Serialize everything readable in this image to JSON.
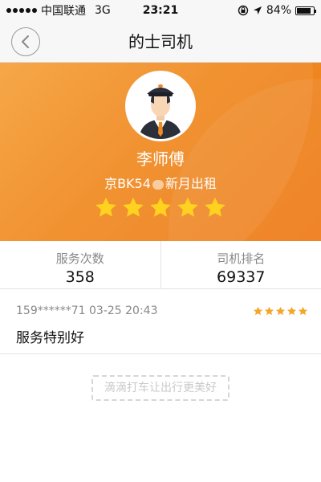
{
  "status_bar": {
    "carrier": "中国联通",
    "network": "3G",
    "time": "23:21",
    "battery_percent": "84%",
    "battery_level": 0.84
  },
  "nav": {
    "title": "的士司机",
    "back_icon": "chevron-left-icon"
  },
  "driver": {
    "name": "李师傅",
    "plate_prefix": "京BK54",
    "company": "新月出租",
    "rating": 5,
    "rating_max": 5
  },
  "stats": {
    "service_label": "服务次数",
    "service_value": "358",
    "rank_label": "司机排名",
    "rank_value": "69337"
  },
  "comment": {
    "user": "159******71",
    "datetime": "03-25 20:43",
    "text": "服务特别好",
    "rating": 5
  },
  "slogan": "滴滴打车让出行更美好",
  "colors": {
    "brand_orange": "#f08a22",
    "star_big": "#ffd21f",
    "star_small": "#f3a72a"
  }
}
